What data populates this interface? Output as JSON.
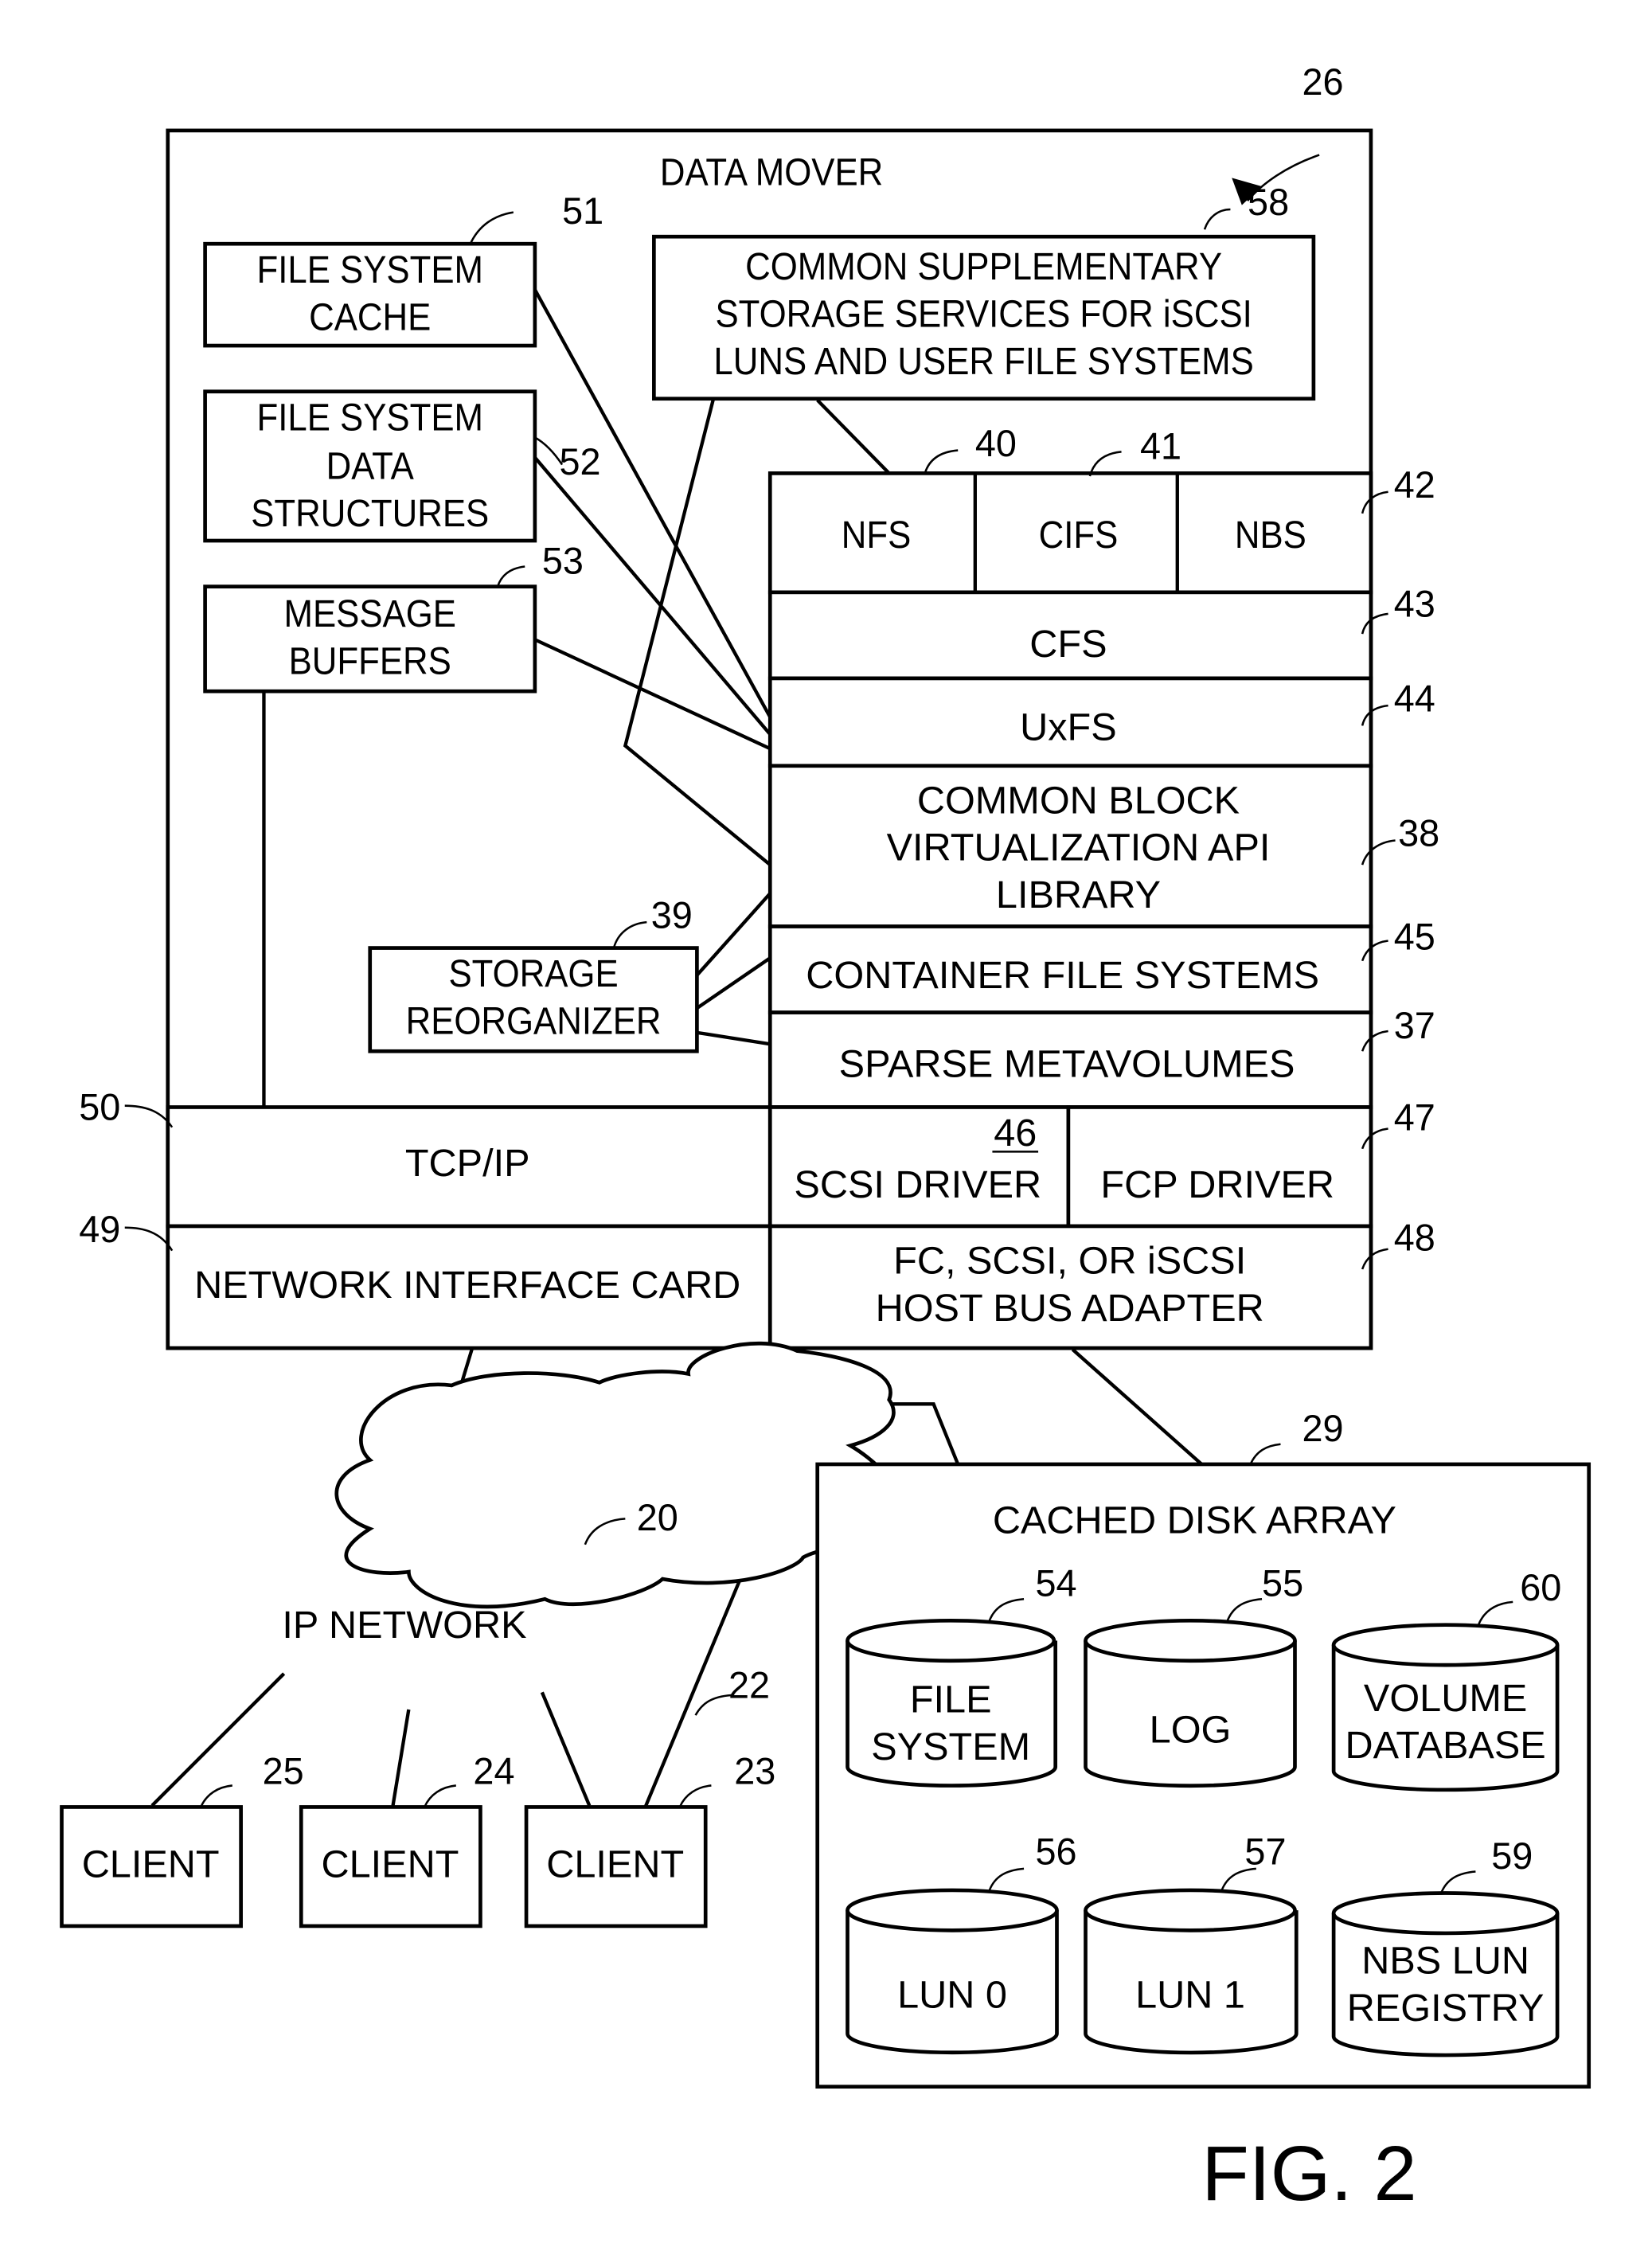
{
  "figure_label": "FIG. 2",
  "data_mover": {
    "title": "DATA MOVER",
    "ref": "26",
    "file_system_cache": {
      "lines": [
        "FILE SYSTEM",
        "CACHE"
      ],
      "ref": "51"
    },
    "file_system_data_structures": {
      "lines": [
        "FILE SYSTEM",
        "DATA",
        "STRUCTURES"
      ],
      "ref": "52"
    },
    "message_buffers": {
      "lines": [
        "MESSAGE",
        "BUFFERS"
      ],
      "ref": "53"
    },
    "storage_reorganizer": {
      "lines": [
        "STORAGE",
        "REORGANIZER"
      ],
      "ref": "39"
    },
    "supplementary_services": {
      "lines": [
        "COMMON SUPPLEMENTARY",
        "STORAGE SERVICES FOR  iSCSI",
        "LUNS AND USER FILE SYSTEMS"
      ],
      "ref": "58"
    },
    "protocols": [
      {
        "label": "NFS",
        "ref": "40"
      },
      {
        "label": "CIFS",
        "ref": "41"
      },
      {
        "label": "NBS",
        "ref": "42"
      }
    ],
    "cfs": {
      "label": "CFS",
      "ref": "43"
    },
    "uxfs": {
      "label": "UxFS",
      "ref": "44"
    },
    "cbv_api": {
      "lines": [
        "COMMON BLOCK",
        "VIRTUALIZATION API",
        "LIBRARY"
      ],
      "ref": "38"
    },
    "container_fs": {
      "label": "CONTAINER FILE SYSTEMS",
      "ref": "45"
    },
    "sparse_metavolumes": {
      "label": "SPARSE METAVOLUMES",
      "ref": "37"
    },
    "tcpip": {
      "label": "TCP/IP",
      "ref": "50"
    },
    "scsi_driver": {
      "label": "SCSI DRIVER",
      "ref": "46"
    },
    "fcp_driver": {
      "label": "FCP DRIVER",
      "ref": "47"
    },
    "nic": {
      "label": "NETWORK INTERFACE CARD",
      "ref": "49"
    },
    "hba": {
      "lines": [
        "FC, SCSI, OR iSCSI",
        "HOST BUS ADAPTER"
      ],
      "ref": "48"
    }
  },
  "network": {
    "label": "IP NETWORK",
    "ref": "20",
    "link_ref": "22"
  },
  "clients": [
    {
      "label": "CLIENT",
      "ref": "25"
    },
    {
      "label": "CLIENT",
      "ref": "24"
    },
    {
      "label": "CLIENT",
      "ref": "23"
    }
  ],
  "disk_array": {
    "title": "CACHED DISK ARRAY",
    "ref": "29",
    "volumes": [
      {
        "lines": [
          "FILE",
          "SYSTEM"
        ],
        "ref": "54"
      },
      {
        "lines": [
          "LOG"
        ],
        "ref": "55"
      },
      {
        "lines": [
          "VOLUME",
          "DATABASE"
        ],
        "ref": "60"
      },
      {
        "lines": [
          "LUN 0"
        ],
        "ref": "56"
      },
      {
        "lines": [
          "LUN 1"
        ],
        "ref": "57"
      },
      {
        "lines": [
          "NBS LUN",
          "REGISTRY"
        ],
        "ref": "59"
      }
    ]
  }
}
